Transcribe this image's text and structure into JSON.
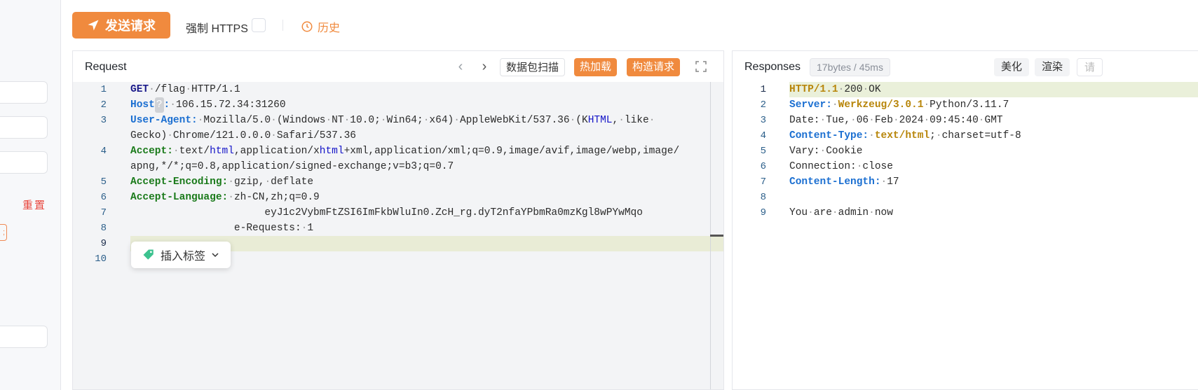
{
  "toolbar": {
    "send_label": "发送请求",
    "https_label": "强制 HTTPS",
    "history_label": "历史"
  },
  "left": {
    "reset_label": "重置"
  },
  "request": {
    "title": "Request",
    "buttons": {
      "scan": "数据包扫描",
      "hotload": "热加载",
      "construct": "构造请求"
    },
    "tag_popup": "插入标签",
    "line_numbers": [
      "1",
      "2",
      "3",
      "",
      "4",
      "",
      "5",
      "6",
      "7",
      "8",
      "9",
      "10"
    ]
  },
  "response": {
    "title": "Responses",
    "badge": "17bytes / 45ms",
    "buttons": {
      "beautify": "美化",
      "render": "渲染",
      "more": "请"
    },
    "line_numbers": [
      "1",
      "2",
      "3",
      "4",
      "5",
      "6",
      "7",
      "8",
      "9"
    ]
  },
  "colors": {
    "accent": "#f08a3e",
    "header_green": "#1a7a1a",
    "header_blue": "#1b6fd1"
  }
}
